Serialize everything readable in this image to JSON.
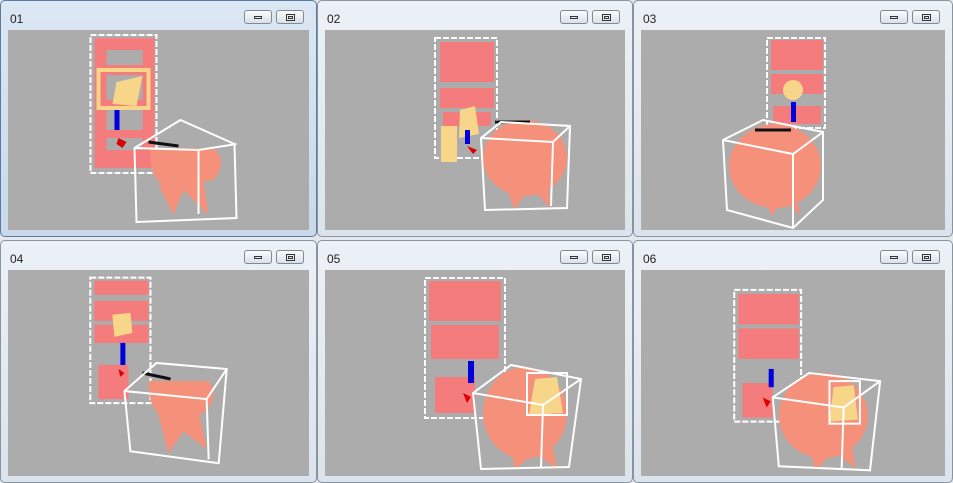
{
  "colors": {
    "viewport_bg": "#acacac",
    "shelf": "#f57c7c",
    "chair": "#f5907a",
    "lamp": "#f7d689",
    "box": "#ffffff",
    "axis_blue": "#0000dd",
    "axis_red": "#dd0000"
  },
  "windows": [
    {
      "title": "01",
      "active": true,
      "minimize_icon": "minimize-icon",
      "maximize_icon": "restore-icon"
    },
    {
      "title": "02",
      "active": false,
      "minimize_icon": "minimize-icon",
      "maximize_icon": "restore-icon"
    },
    {
      "title": "03",
      "active": false,
      "minimize_icon": "minimize-icon",
      "maximize_icon": "restore-icon"
    },
    {
      "title": "04",
      "active": false,
      "minimize_icon": "minimize-icon",
      "maximize_icon": "restore-icon"
    },
    {
      "title": "05",
      "active": false,
      "minimize_icon": "minimize-icon",
      "maximize_icon": "restore-icon"
    },
    {
      "title": "06",
      "active": false,
      "minimize_icon": "minimize-icon",
      "maximize_icon": "restore-icon"
    }
  ]
}
